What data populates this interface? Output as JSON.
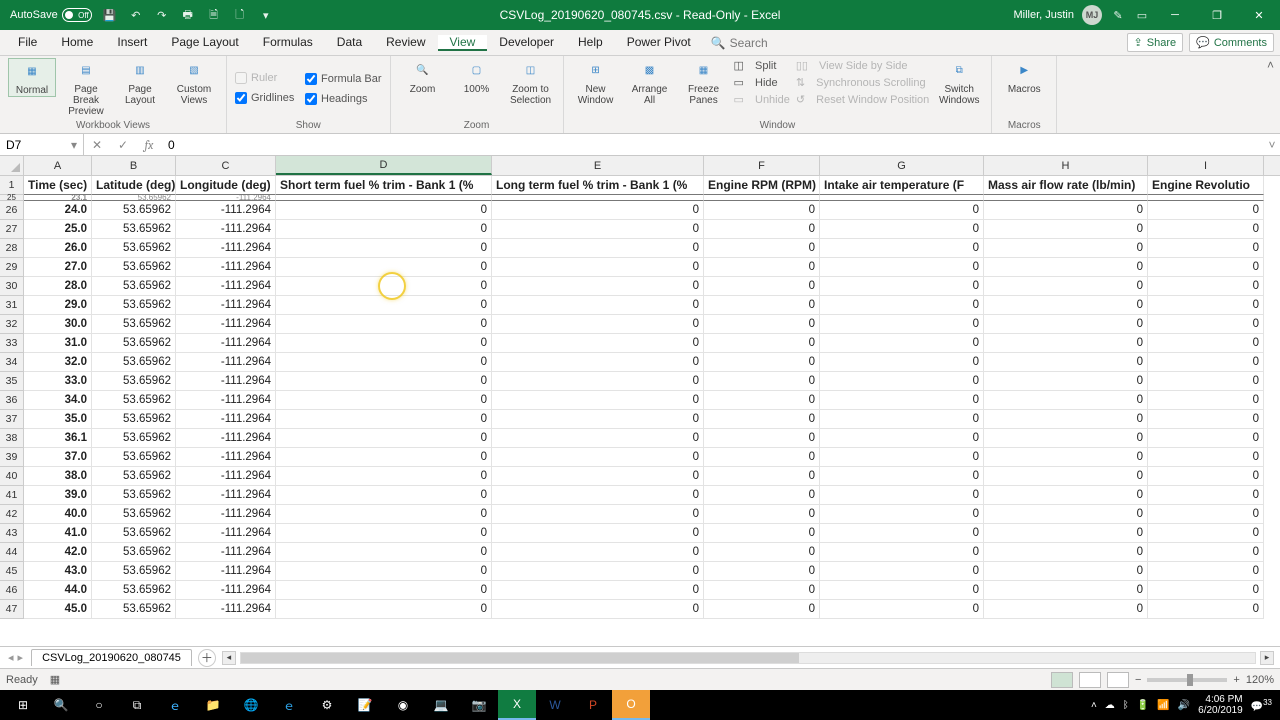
{
  "titlebar": {
    "autosave_label": "AutoSave",
    "autosave_off": "Off",
    "doc_title": "CSVLog_20190620_080745.csv - Read-Only - Excel",
    "user": "Miller, Justin",
    "initials": "MJ"
  },
  "tabs": [
    "File",
    "Home",
    "Insert",
    "Page Layout",
    "Formulas",
    "Data",
    "Review",
    "View",
    "Developer",
    "Help",
    "Power Pivot"
  ],
  "active_tab": 7,
  "search_placeholder": "Search",
  "share_label": "Share",
  "comments_label": "Comments",
  "ribbon": {
    "groups": {
      "views": {
        "label": "Workbook Views",
        "normal": "Normal",
        "pb": "Page Break\nPreview",
        "pl": "Page\nLayout",
        "cv": "Custom\nViews"
      },
      "show": {
        "label": "Show",
        "ruler": "Ruler",
        "formula_bar": "Formula Bar",
        "gridlines": "Gridlines",
        "headings": "Headings"
      },
      "zoom": {
        "label": "Zoom",
        "zoom": "Zoom",
        "z100": "100%",
        "zsel": "Zoom to\nSelection"
      },
      "window": {
        "label": "Window",
        "new": "New\nWindow",
        "arrange": "Arrange\nAll",
        "freeze": "Freeze\nPanes",
        "split": "Split",
        "hide": "Hide",
        "unhide": "Unhide",
        "sbs": "View Side by Side",
        "sync": "Synchronous Scrolling",
        "reset": "Reset Window Position",
        "switch": "Switch\nWindows"
      },
      "macros": {
        "label": "Macros",
        "macros": "Macros"
      }
    }
  },
  "namebox": "D7",
  "formula_value": "0",
  "columns": [
    "A",
    "B",
    "C",
    "D",
    "E",
    "F",
    "G",
    "H",
    "I"
  ],
  "column_widths": [
    "cA",
    "cB",
    "cC",
    "cD",
    "cE",
    "cF",
    "cG",
    "cH",
    "cI"
  ],
  "selected_col": 3,
  "header_row_num": "1",
  "headers": [
    "Time (sec)",
    "Latitude (deg)",
    "Longitude (deg)",
    "Short term fuel % trim - Bank 1 (%",
    "Long term fuel % trim - Bank 1 (%",
    "Engine RPM (RPM)",
    "Intake air temperature (F",
    "Mass air flow rate (lb/min)",
    "Engine Revolutio"
  ],
  "peek_row_num": "25",
  "peek_row": [
    "23.1",
    "53.65962",
    "-111.2964",
    "",
    "",
    "",
    "",
    "",
    ""
  ],
  "rows": [
    {
      "n": "26",
      "v": [
        "24.0",
        "53.65962",
        "-111.2964",
        "0",
        "0",
        "0",
        "0",
        "0",
        "0"
      ]
    },
    {
      "n": "27",
      "v": [
        "25.0",
        "53.65962",
        "-111.2964",
        "0",
        "0",
        "0",
        "0",
        "0",
        "0"
      ]
    },
    {
      "n": "28",
      "v": [
        "26.0",
        "53.65962",
        "-111.2964",
        "0",
        "0",
        "0",
        "0",
        "0",
        "0"
      ]
    },
    {
      "n": "29",
      "v": [
        "27.0",
        "53.65962",
        "-111.2964",
        "0",
        "0",
        "0",
        "0",
        "0",
        "0"
      ]
    },
    {
      "n": "30",
      "v": [
        "28.0",
        "53.65962",
        "-111.2964",
        "0",
        "0",
        "0",
        "0",
        "0",
        "0"
      ]
    },
    {
      "n": "31",
      "v": [
        "29.0",
        "53.65962",
        "-111.2964",
        "0",
        "0",
        "0",
        "0",
        "0",
        "0"
      ]
    },
    {
      "n": "32",
      "v": [
        "30.0",
        "53.65962",
        "-111.2964",
        "0",
        "0",
        "0",
        "0",
        "0",
        "0"
      ]
    },
    {
      "n": "33",
      "v": [
        "31.0",
        "53.65962",
        "-111.2964",
        "0",
        "0",
        "0",
        "0",
        "0",
        "0"
      ]
    },
    {
      "n": "34",
      "v": [
        "32.0",
        "53.65962",
        "-111.2964",
        "0",
        "0",
        "0",
        "0",
        "0",
        "0"
      ]
    },
    {
      "n": "35",
      "v": [
        "33.0",
        "53.65962",
        "-111.2964",
        "0",
        "0",
        "0",
        "0",
        "0",
        "0"
      ]
    },
    {
      "n": "36",
      "v": [
        "34.0",
        "53.65962",
        "-111.2964",
        "0",
        "0",
        "0",
        "0",
        "0",
        "0"
      ]
    },
    {
      "n": "37",
      "v": [
        "35.0",
        "53.65962",
        "-111.2964",
        "0",
        "0",
        "0",
        "0",
        "0",
        "0"
      ]
    },
    {
      "n": "38",
      "v": [
        "36.1",
        "53.65962",
        "-111.2964",
        "0",
        "0",
        "0",
        "0",
        "0",
        "0"
      ]
    },
    {
      "n": "39",
      "v": [
        "37.0",
        "53.65962",
        "-111.2964",
        "0",
        "0",
        "0",
        "0",
        "0",
        "0"
      ]
    },
    {
      "n": "40",
      "v": [
        "38.0",
        "53.65962",
        "-111.2964",
        "0",
        "0",
        "0",
        "0",
        "0",
        "0"
      ]
    },
    {
      "n": "41",
      "v": [
        "39.0",
        "53.65962",
        "-111.2964",
        "0",
        "0",
        "0",
        "0",
        "0",
        "0"
      ]
    },
    {
      "n": "42",
      "v": [
        "40.0",
        "53.65962",
        "-111.2964",
        "0",
        "0",
        "0",
        "0",
        "0",
        "0"
      ]
    },
    {
      "n": "43",
      "v": [
        "41.0",
        "53.65962",
        "-111.2964",
        "0",
        "0",
        "0",
        "0",
        "0",
        "0"
      ]
    },
    {
      "n": "44",
      "v": [
        "42.0",
        "53.65962",
        "-111.2964",
        "0",
        "0",
        "0",
        "0",
        "0",
        "0"
      ]
    },
    {
      "n": "45",
      "v": [
        "43.0",
        "53.65962",
        "-111.2964",
        "0",
        "0",
        "0",
        "0",
        "0",
        "0"
      ]
    },
    {
      "n": "46",
      "v": [
        "44.0",
        "53.65962",
        "-111.2964",
        "0",
        "0",
        "0",
        "0",
        "0",
        "0"
      ]
    },
    {
      "n": "47",
      "v": [
        "45.0",
        "53.65962",
        "-111.2964",
        "0",
        "0",
        "0",
        "0",
        "0",
        "0"
      ]
    }
  ],
  "sheet_tab": "CSVLog_20190620_080745",
  "status": {
    "ready": "Ready",
    "zoom": "120%",
    "notif": "33"
  },
  "tray": {
    "time": "4:06 PM",
    "date": "6/20/2019"
  }
}
